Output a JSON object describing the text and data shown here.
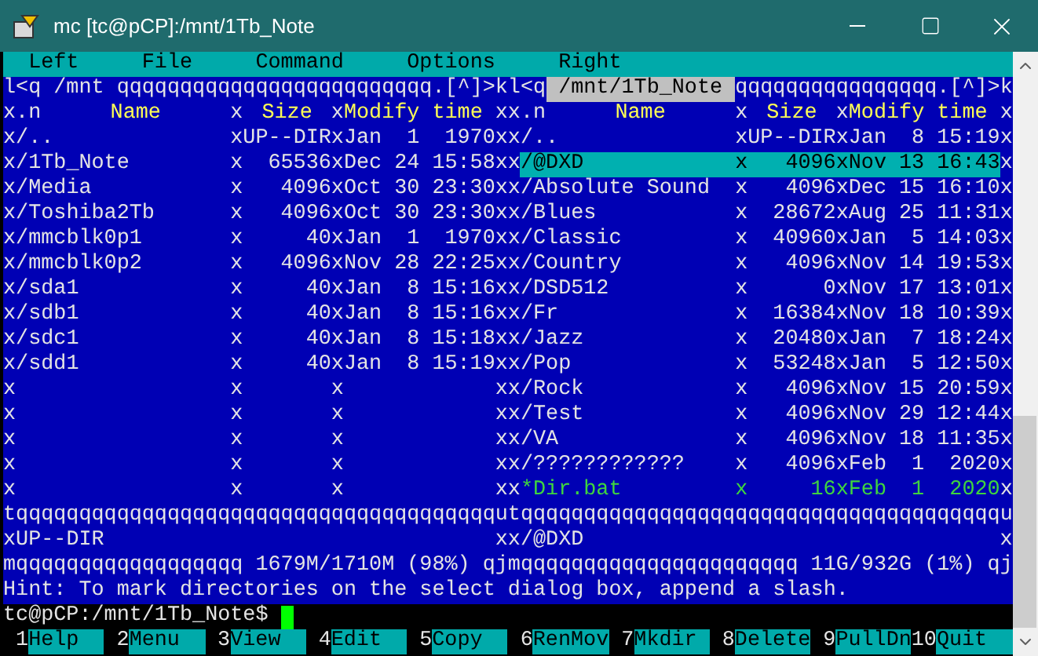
{
  "window": {
    "title": "mc [tc@pCP]:/mnt/1Tb_Note"
  },
  "menu": [
    "Left",
    "File",
    "Command",
    "Options",
    "Right"
  ],
  "panels": [
    {
      "active": false,
      "frame_start": "l<q",
      "path": " /mnt ",
      "frame_end": "qqqqqqqqqqqqqqqqqqqqqqqqq.[^]>k",
      "header": [
        "x",
        ".n",
        "Name",
        "x",
        "Size",
        "x",
        "Modify time",
        "x"
      ],
      "rows": [
        {
          "kind": "dir",
          "selected": false,
          "cells": [
            "x",
            "/..",
            "x",
            "UP--DIR",
            "x",
            "Jan  1  1970",
            "x"
          ]
        },
        {
          "kind": "dir",
          "selected": false,
          "cells": [
            "x",
            "/1Tb_Note",
            "x",
            "65536",
            "x",
            "Dec 24 15:58",
            "x"
          ]
        },
        {
          "kind": "dir",
          "selected": false,
          "cells": [
            "x",
            "/Media",
            "x",
            "4096",
            "x",
            "Oct 30 23:30",
            "x"
          ]
        },
        {
          "kind": "dir",
          "selected": false,
          "cells": [
            "x",
            "/Toshiba2Tb",
            "x",
            "4096",
            "x",
            "Oct 30 23:30",
            "x"
          ]
        },
        {
          "kind": "dir",
          "selected": false,
          "cells": [
            "x",
            "/mmcblk0p1",
            "x",
            "40",
            "x",
            "Jan  1  1970",
            "x"
          ]
        },
        {
          "kind": "dir",
          "selected": false,
          "cells": [
            "x",
            "/mmcblk0p2",
            "x",
            "4096",
            "x",
            "Nov 28 22:25",
            "x"
          ]
        },
        {
          "kind": "dir",
          "selected": false,
          "cells": [
            "x",
            "/sda1",
            "x",
            "40",
            "x",
            "Jan  8 15:16",
            "x"
          ]
        },
        {
          "kind": "dir",
          "selected": false,
          "cells": [
            "x",
            "/sdb1",
            "x",
            "40",
            "x",
            "Jan  8 15:16",
            "x"
          ]
        },
        {
          "kind": "dir",
          "selected": false,
          "cells": [
            "x",
            "/sdc1",
            "x",
            "40",
            "x",
            "Jan  8 15:18",
            "x"
          ]
        },
        {
          "kind": "dir",
          "selected": false,
          "cells": [
            "x",
            "/sdd1",
            "x",
            "40",
            "x",
            "Jan  8 15:19",
            "x"
          ]
        },
        {
          "kind": "empty",
          "selected": false,
          "cells": [
            "x",
            "x",
            "x",
            "x"
          ]
        },
        {
          "kind": "empty",
          "selected": false,
          "cells": [
            "x",
            "x",
            "x",
            "x"
          ]
        },
        {
          "kind": "empty",
          "selected": false,
          "cells": [
            "x",
            "x",
            "x",
            "x"
          ]
        },
        {
          "kind": "empty",
          "selected": false,
          "cells": [
            "x",
            "x",
            "x",
            "x"
          ]
        },
        {
          "kind": "empty",
          "selected": false,
          "cells": [
            "x",
            "x",
            "x",
            "x"
          ]
        }
      ],
      "separator": "tqqqqqqqqqqqqqqqqqqqqqqqqqqqqqqqqqqqqqqu",
      "status": [
        "x",
        "UP--DIR",
        "x"
      ],
      "footer": [
        "mqqqqqqqqqqqqqqqqqq",
        " 1679M/1710M (98%) ",
        "qj"
      ]
    },
    {
      "active": true,
      "frame_start": "l<q",
      "path": " /mnt/1Tb_Note ",
      "frame_end": "qqqqqqqqqqqqqqqq.[^]>k",
      "header": [
        "x",
        ".n",
        "Name",
        "x",
        "Size",
        "x",
        "Modify time",
        "x"
      ],
      "rows": [
        {
          "kind": "dir",
          "selected": false,
          "cells": [
            "x",
            "/..",
            "x",
            "UP--DIR",
            "x",
            "Jan  8 15:19",
            "x"
          ]
        },
        {
          "kind": "dir",
          "selected": true,
          "cells": [
            "x",
            "/@DXD",
            "x",
            "4096",
            "x",
            "Nov 13 16:43",
            "x"
          ]
        },
        {
          "kind": "dir",
          "selected": false,
          "cells": [
            "x",
            "/Absolute Sound",
            "x",
            "4096",
            "x",
            "Dec 15 16:10",
            "x"
          ]
        },
        {
          "kind": "dir",
          "selected": false,
          "cells": [
            "x",
            "/Blues",
            "x",
            "28672",
            "x",
            "Aug 25 11:31",
            "x"
          ]
        },
        {
          "kind": "dir",
          "selected": false,
          "cells": [
            "x",
            "/Classic",
            "x",
            "40960",
            "x",
            "Jan  5 14:03",
            "x"
          ]
        },
        {
          "kind": "dir",
          "selected": false,
          "cells": [
            "x",
            "/Country",
            "x",
            "4096",
            "x",
            "Nov 14 19:53",
            "x"
          ]
        },
        {
          "kind": "dir",
          "selected": false,
          "cells": [
            "x",
            "/DSD512",
            "x",
            "0",
            "x",
            "Nov 17 13:01",
            "x"
          ]
        },
        {
          "kind": "dir",
          "selected": false,
          "cells": [
            "x",
            "/Fr",
            "x",
            "16384",
            "x",
            "Nov 18 10:39",
            "x"
          ]
        },
        {
          "kind": "dir",
          "selected": false,
          "cells": [
            "x",
            "/Jazz",
            "x",
            "20480",
            "x",
            "Jan  7 18:24",
            "x"
          ]
        },
        {
          "kind": "dir",
          "selected": false,
          "cells": [
            "x",
            "/Pop",
            "x",
            "53248",
            "x",
            "Jan  5 12:50",
            "x"
          ]
        },
        {
          "kind": "dir",
          "selected": false,
          "cells": [
            "x",
            "/Rock",
            "x",
            "4096",
            "x",
            "Nov 15 20:59",
            "x"
          ]
        },
        {
          "kind": "dir",
          "selected": false,
          "cells": [
            "x",
            "/Test",
            "x",
            "4096",
            "x",
            "Nov 29 12:44",
            "x"
          ]
        },
        {
          "kind": "dir",
          "selected": false,
          "cells": [
            "x",
            "/VA",
            "x",
            "4096",
            "x",
            "Nov 18 11:35",
            "x"
          ]
        },
        {
          "kind": "dir",
          "selected": false,
          "cells": [
            "x",
            "/????????????",
            "x",
            "4096",
            "x",
            "Feb  1  2020",
            "x"
          ]
        },
        {
          "kind": "exec",
          "selected": false,
          "cells": [
            "x",
            "*Dir.bat",
            "x",
            "16",
            "x",
            "Feb  1  2020",
            "x"
          ]
        }
      ],
      "separator": "tqqqqqqqqqqqqqqqqqqqqqqqqqqqqqqqqqqqqqqu",
      "status": [
        "x",
        "/@DXD",
        "x"
      ],
      "footer": [
        "mqqqqqqqqqqqqqqqqqqqqqq",
        " 11G/932G (1%) ",
        "qj"
      ]
    }
  ],
  "hint": "Hint: To mark directories on the select dialog box, append a slash.",
  "prompt": "tc@pCP:/mnt/1Tb_Note$",
  "function_keys": [
    {
      "number": "1",
      "label": "Help"
    },
    {
      "number": "2",
      "label": "Menu"
    },
    {
      "number": "3",
      "label": "View"
    },
    {
      "number": "4",
      "label": "Edit"
    },
    {
      "number": "5",
      "label": "Copy"
    },
    {
      "number": "6",
      "label": "RenMov"
    },
    {
      "number": "7",
      "label": "Mkdir"
    },
    {
      "number": "8",
      "label": "Delete"
    },
    {
      "number": "9",
      "label": "PullDn"
    },
    {
      "number": "10",
      "label": "Quit"
    }
  ]
}
